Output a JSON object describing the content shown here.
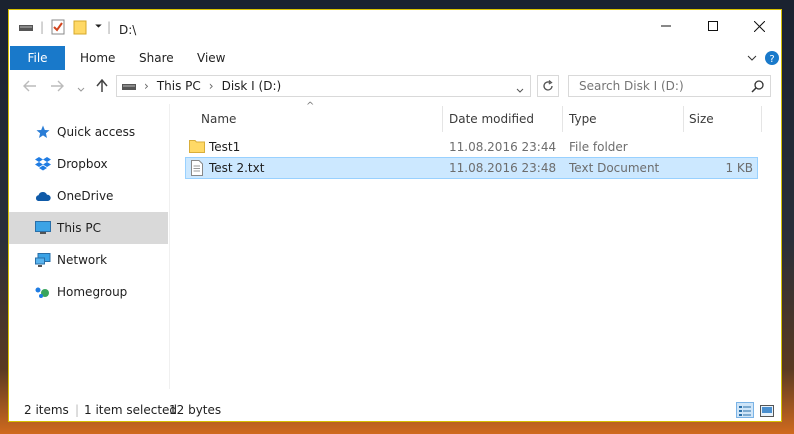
{
  "window": {
    "title": "D:\\"
  },
  "title_controls": {
    "minimize": "—",
    "maximize": "☐",
    "close": "✕"
  },
  "ribbon": {
    "tabs": [
      {
        "label": "File"
      },
      {
        "label": "Home"
      },
      {
        "label": "Share"
      },
      {
        "label": "View"
      }
    ]
  },
  "address": {
    "breadcrumb": [
      "This PC",
      "Disk I (D:)"
    ],
    "separator": "›"
  },
  "search": {
    "placeholder": "Search Disk I (D:)"
  },
  "nav": {
    "items": [
      {
        "label": "Quick access",
        "icon": "star-icon"
      },
      {
        "label": "Dropbox",
        "icon": "dropbox-icon"
      },
      {
        "label": "OneDrive",
        "icon": "onedrive-icon"
      },
      {
        "label": "This PC",
        "icon": "monitor-icon",
        "selected": true
      },
      {
        "label": "Network",
        "icon": "network-icon"
      },
      {
        "label": "Homegroup",
        "icon": "homegroup-icon"
      }
    ]
  },
  "columns": {
    "name": "Name",
    "date": "Date modified",
    "type": "Type",
    "size": "Size",
    "sort_indicator": "^"
  },
  "files": [
    {
      "name": "Test1",
      "date": "11.08.2016 23:44",
      "type": "File folder",
      "size": "",
      "icon": "folder-icon",
      "selected": false
    },
    {
      "name": "Test 2.txt",
      "date": "11.08.2016 23:48",
      "type": "Text Document",
      "size": "1 KB",
      "icon": "text-file-icon",
      "selected": true
    }
  ],
  "status": {
    "items_count": "2 items",
    "selection": "1 item selected",
    "selection_size": "12 bytes"
  },
  "colors": {
    "accent": "#1979ca",
    "selection_bg": "#cce8ff",
    "selection_border": "#99d1ff",
    "window_border": "#d7c000"
  }
}
